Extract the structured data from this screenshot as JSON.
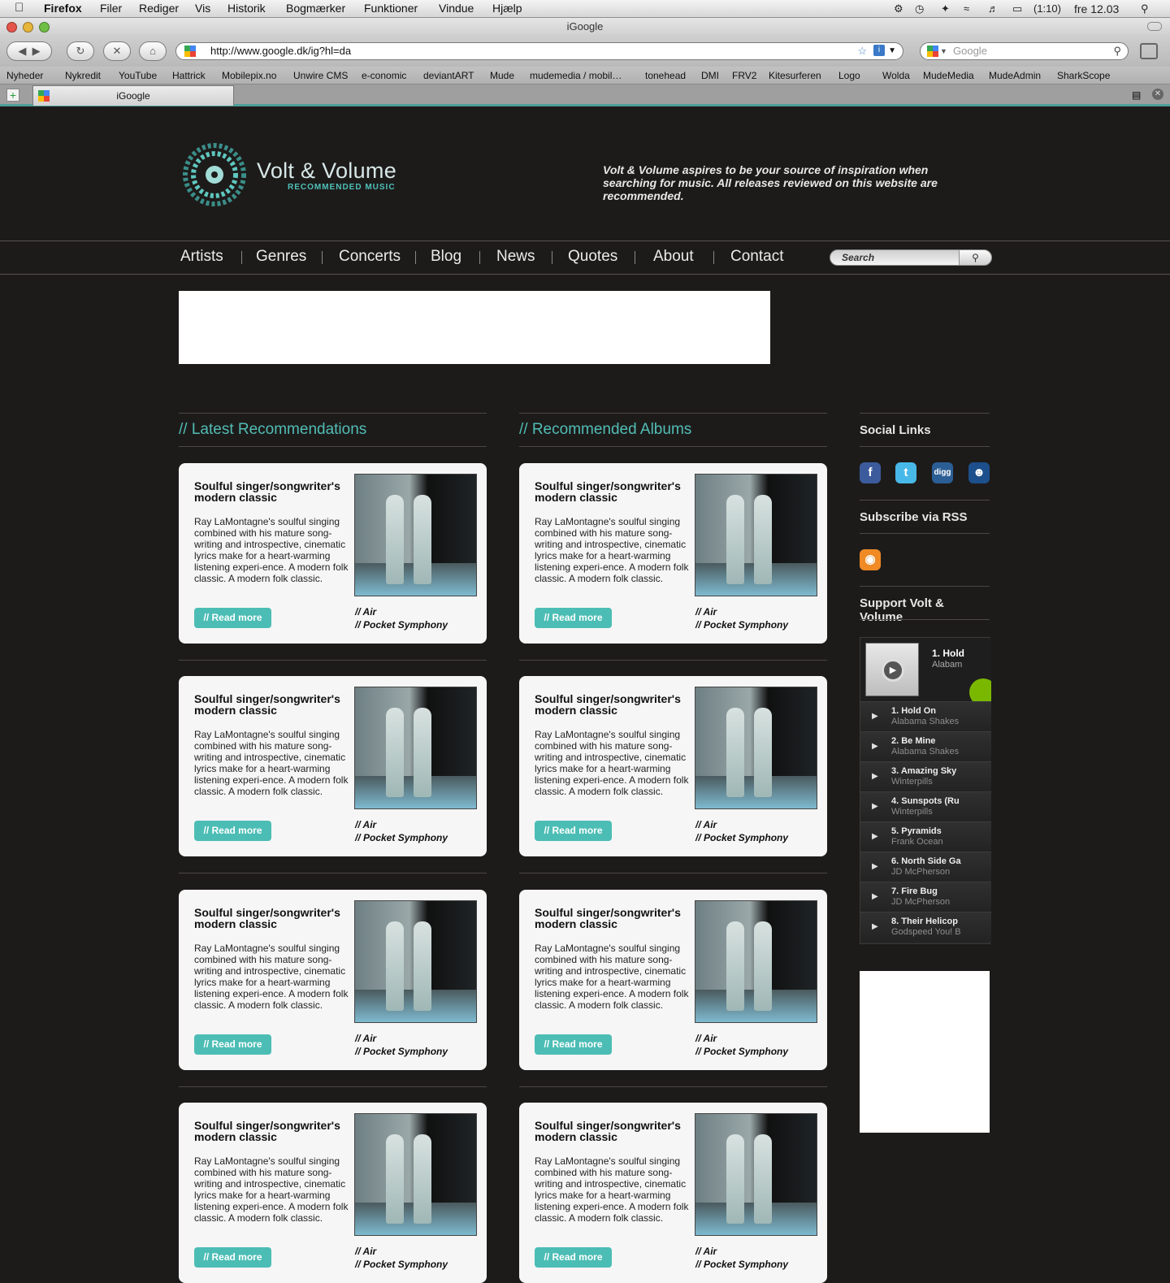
{
  "menubar": {
    "app": "Firefox",
    "items": [
      "Filer",
      "Rediger",
      "Vis",
      "Historik",
      "Bogmærker",
      "Funktioner",
      "Vindue",
      "Hjælp"
    ],
    "battery": "(1:10)",
    "clock": "fre 12.03"
  },
  "window": {
    "title": "iGoogle"
  },
  "toolbar": {
    "url": "http://www.google.dk/ig?hl=da",
    "search_placeholder": "Google"
  },
  "bookmarks": [
    "Nyheder",
    "Nykredit",
    "YouTube",
    "Hattrick",
    "Mobilepix.no",
    "Unwire CMS",
    "e-conomic",
    "deviantART",
    "Mude",
    "mudemedia / mobil…",
    "tonehead",
    "DMI",
    "FRV2",
    "Kitesurferen",
    "Logo",
    "Wolda",
    "MudeMedia",
    "MudeAdmin",
    "SharkScope"
  ],
  "tab": {
    "label": "iGoogle"
  },
  "site": {
    "brand": "Volt & Volume",
    "brand_sub": "RECOMMENDED MUSIC",
    "tagline": "Volt & Volume aspires to be your source of inspiration when searching for music. All releases reviewed on this website are recommended.",
    "nav": [
      "Artists",
      "Genres",
      "Concerts",
      "Blog",
      "News",
      "Quotes",
      "About",
      "Contact"
    ],
    "search_placeholder": "Search"
  },
  "columns": {
    "left_title": "//  Latest Recommendations",
    "right_title": "//  Recommended Albums"
  },
  "card": {
    "title": "Soulful singer/songwriter's modern classic",
    "text": "Ray LaMontagne's soulful singing combined with his mature song-writing and introspective, cinematic lyrics make for a heart-warming listening experi-ence. A modern folk classic. A modern folk classic.",
    "read_more": "// Read more",
    "artist": "// Air",
    "album": "// Pocket Symphony"
  },
  "sidebar": {
    "social_title": "Social Links",
    "rss_title": "Subscribe via RSS",
    "support_title": "Support Volt & Volume"
  },
  "player": {
    "now_title": "1. Hold",
    "now_artist": "Alabam",
    "tracks": [
      {
        "name": "1. Hold On",
        "artist": "Alabama Shakes"
      },
      {
        "name": "2. Be Mine",
        "artist": "Alabama Shakes"
      },
      {
        "name": "3. Amazing Sky",
        "artist": "Winterpills"
      },
      {
        "name": "4. Sunspots (Ru",
        "artist": "Winterpills"
      },
      {
        "name": "5. Pyramids",
        "artist": "Frank Ocean"
      },
      {
        "name": "6. North Side Ga",
        "artist": "JD McPherson"
      },
      {
        "name": "7. Fire Bug",
        "artist": "JD McPherson"
      },
      {
        "name": "8. Their Helicop",
        "artist": "Godspeed You! B"
      }
    ]
  }
}
